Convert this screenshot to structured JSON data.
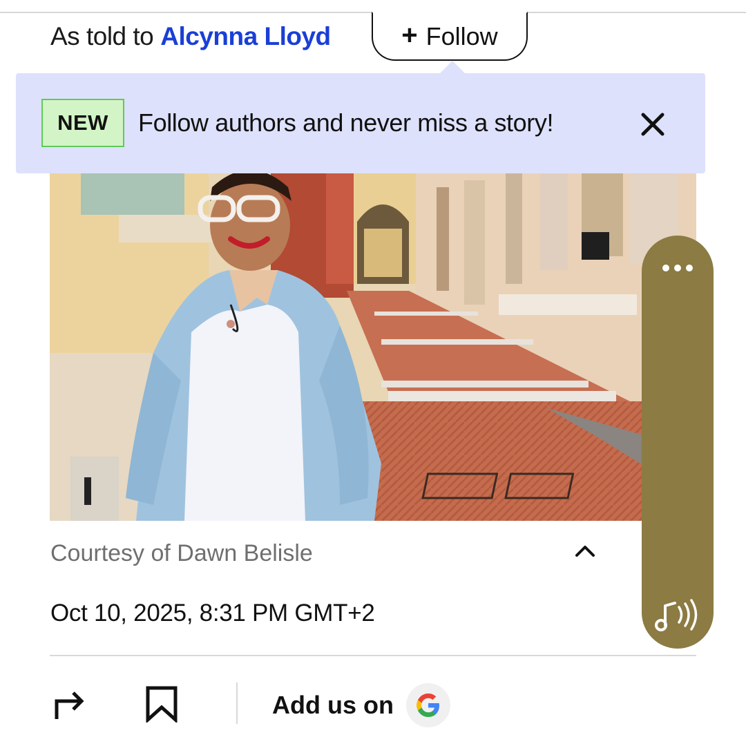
{
  "byline": {
    "prefix": "As told to",
    "author": "Alcynna Lloyd"
  },
  "follow_button": {
    "label": "Follow",
    "icon": "plus-icon"
  },
  "tooltip": {
    "badge": "NEW",
    "text": "Follow authors and never miss a story!",
    "close_icon": "close-icon",
    "background": "#dde1fc",
    "badge_color": "#d3f4c6"
  },
  "photo": {
    "alt": "Woman in denim jacket walking down a street"
  },
  "caption": {
    "text": "Courtesy of Dawn Belisle",
    "toggle_icon": "chevron-up-icon"
  },
  "date": "Oct 10, 2025, 8:31 PM GMT+2",
  "actions": {
    "share_icon": "share-icon",
    "bookmark_icon": "bookmark-icon",
    "add_us_label": "Add us on",
    "google_icon": "google-icon"
  },
  "audio_player": {
    "more_icon": "more-dots-icon",
    "play_icon": "audio-note-icon",
    "color": "#8c7b42"
  },
  "colors": {
    "link": "#1a3fd6",
    "caption": "#6f6f6f"
  }
}
